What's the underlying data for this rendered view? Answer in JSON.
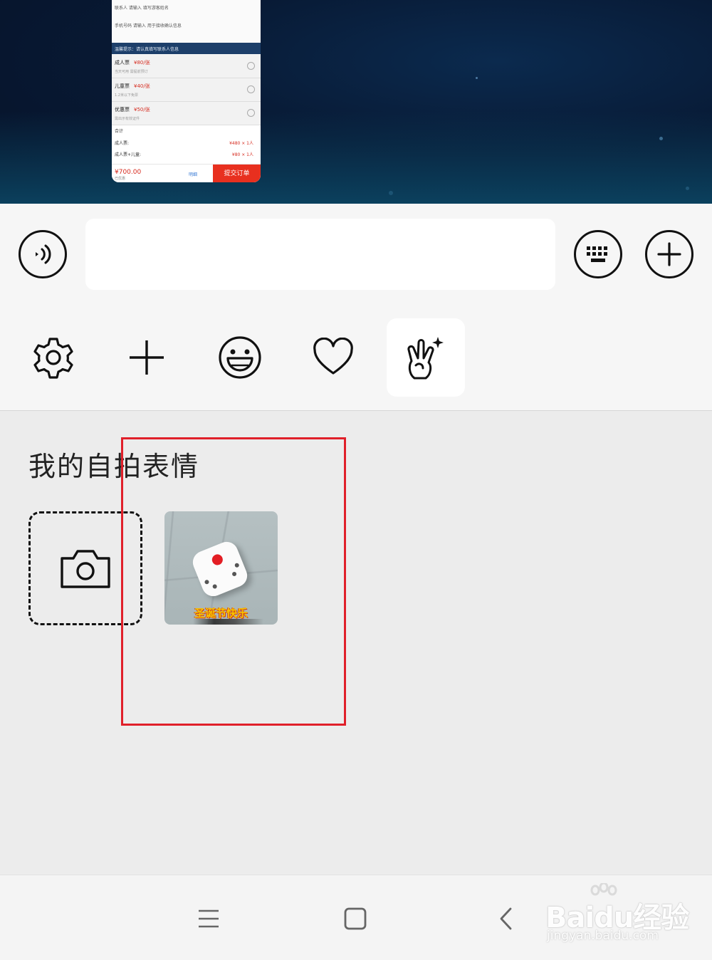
{
  "shared_screenshot": {
    "rows": [
      "联系人    请输入   填写游客姓名",
      "手机号码   请输入   用于接收确认信息"
    ],
    "band": "温馨提示：请认真填写联系人信息",
    "items": [
      {
        "name": "成人票",
        "price": "¥80/张",
        "sub": "当天可用  需提前预订"
      },
      {
        "name": "儿童票",
        "price": "¥40/张",
        "sub": "1.2米以下免票"
      },
      {
        "name": "优惠票",
        "price": "¥50/张",
        "sub": "需出示有效证件"
      }
    ],
    "summary_label": "合计",
    "summary_lines": [
      {
        "label": "成人票:",
        "value": "¥480 × 1人"
      },
      {
        "label": "成人票+儿童:",
        "value": "¥80 × 1人"
      }
    ],
    "total": "¥700.00",
    "total_note": "已优惠",
    "detail": "明细",
    "submit": "提交订单"
  },
  "input_bar": {
    "voice_icon": "voice-icon",
    "keyboard_icon": "keyboard-icon",
    "plus_icon": "plus-circle-icon",
    "placeholder": ""
  },
  "tools": [
    {
      "icon": "gear-icon"
    },
    {
      "icon": "plus-icon"
    },
    {
      "icon": "smiley-icon"
    },
    {
      "icon": "heart-icon"
    },
    {
      "icon": "selfie-sticker-icon",
      "active": true
    }
  ],
  "panel": {
    "title": "我的自拍表情",
    "camera_icon": "camera-icon",
    "sticker_caption": "圣诞节快乐"
  },
  "nav": {
    "menu_icon": "menu-icon",
    "home_icon": "home-square-icon",
    "back_icon": "back-chevron-icon"
  },
  "watermark": {
    "brand": "Baidu经验",
    "url": "jingyan.baidu.com"
  },
  "colors": {
    "highlight": "#e0202a",
    "accent_red": "#e8301f"
  }
}
